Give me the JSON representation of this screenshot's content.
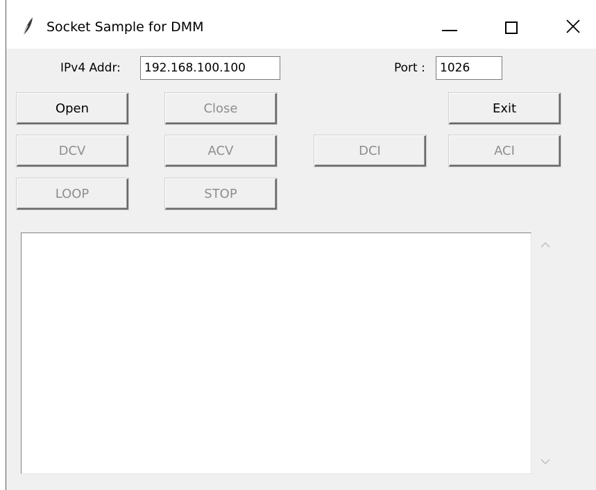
{
  "window": {
    "title": "Socket Sample for DMM",
    "icons": {
      "app": "feather-icon",
      "minimize": "minimize-icon",
      "maximize": "maximize-icon",
      "close": "close-icon"
    }
  },
  "connection": {
    "ipv4_label": "IPv4 Addr:",
    "ipv4_value": "192.168.100.100",
    "port_label": "Port :",
    "port_value": "1026"
  },
  "buttons": {
    "open": "Open",
    "close": "Close",
    "exit": "Exit",
    "dcv": "DCV",
    "acv": "ACV",
    "dci": "DCI",
    "aci": "ACI",
    "loop": "LOOP",
    "stop": "STOP"
  },
  "output": {
    "text": ""
  },
  "scrollbar": {
    "icons": {
      "up": "scroll-up-arrow-icon",
      "down": "scroll-down-arrow-icon"
    }
  },
  "colors": {
    "window_background": "#f0f0f0",
    "titlebar_background": "#ffffff",
    "disabled_text": "#8e8e8e"
  }
}
